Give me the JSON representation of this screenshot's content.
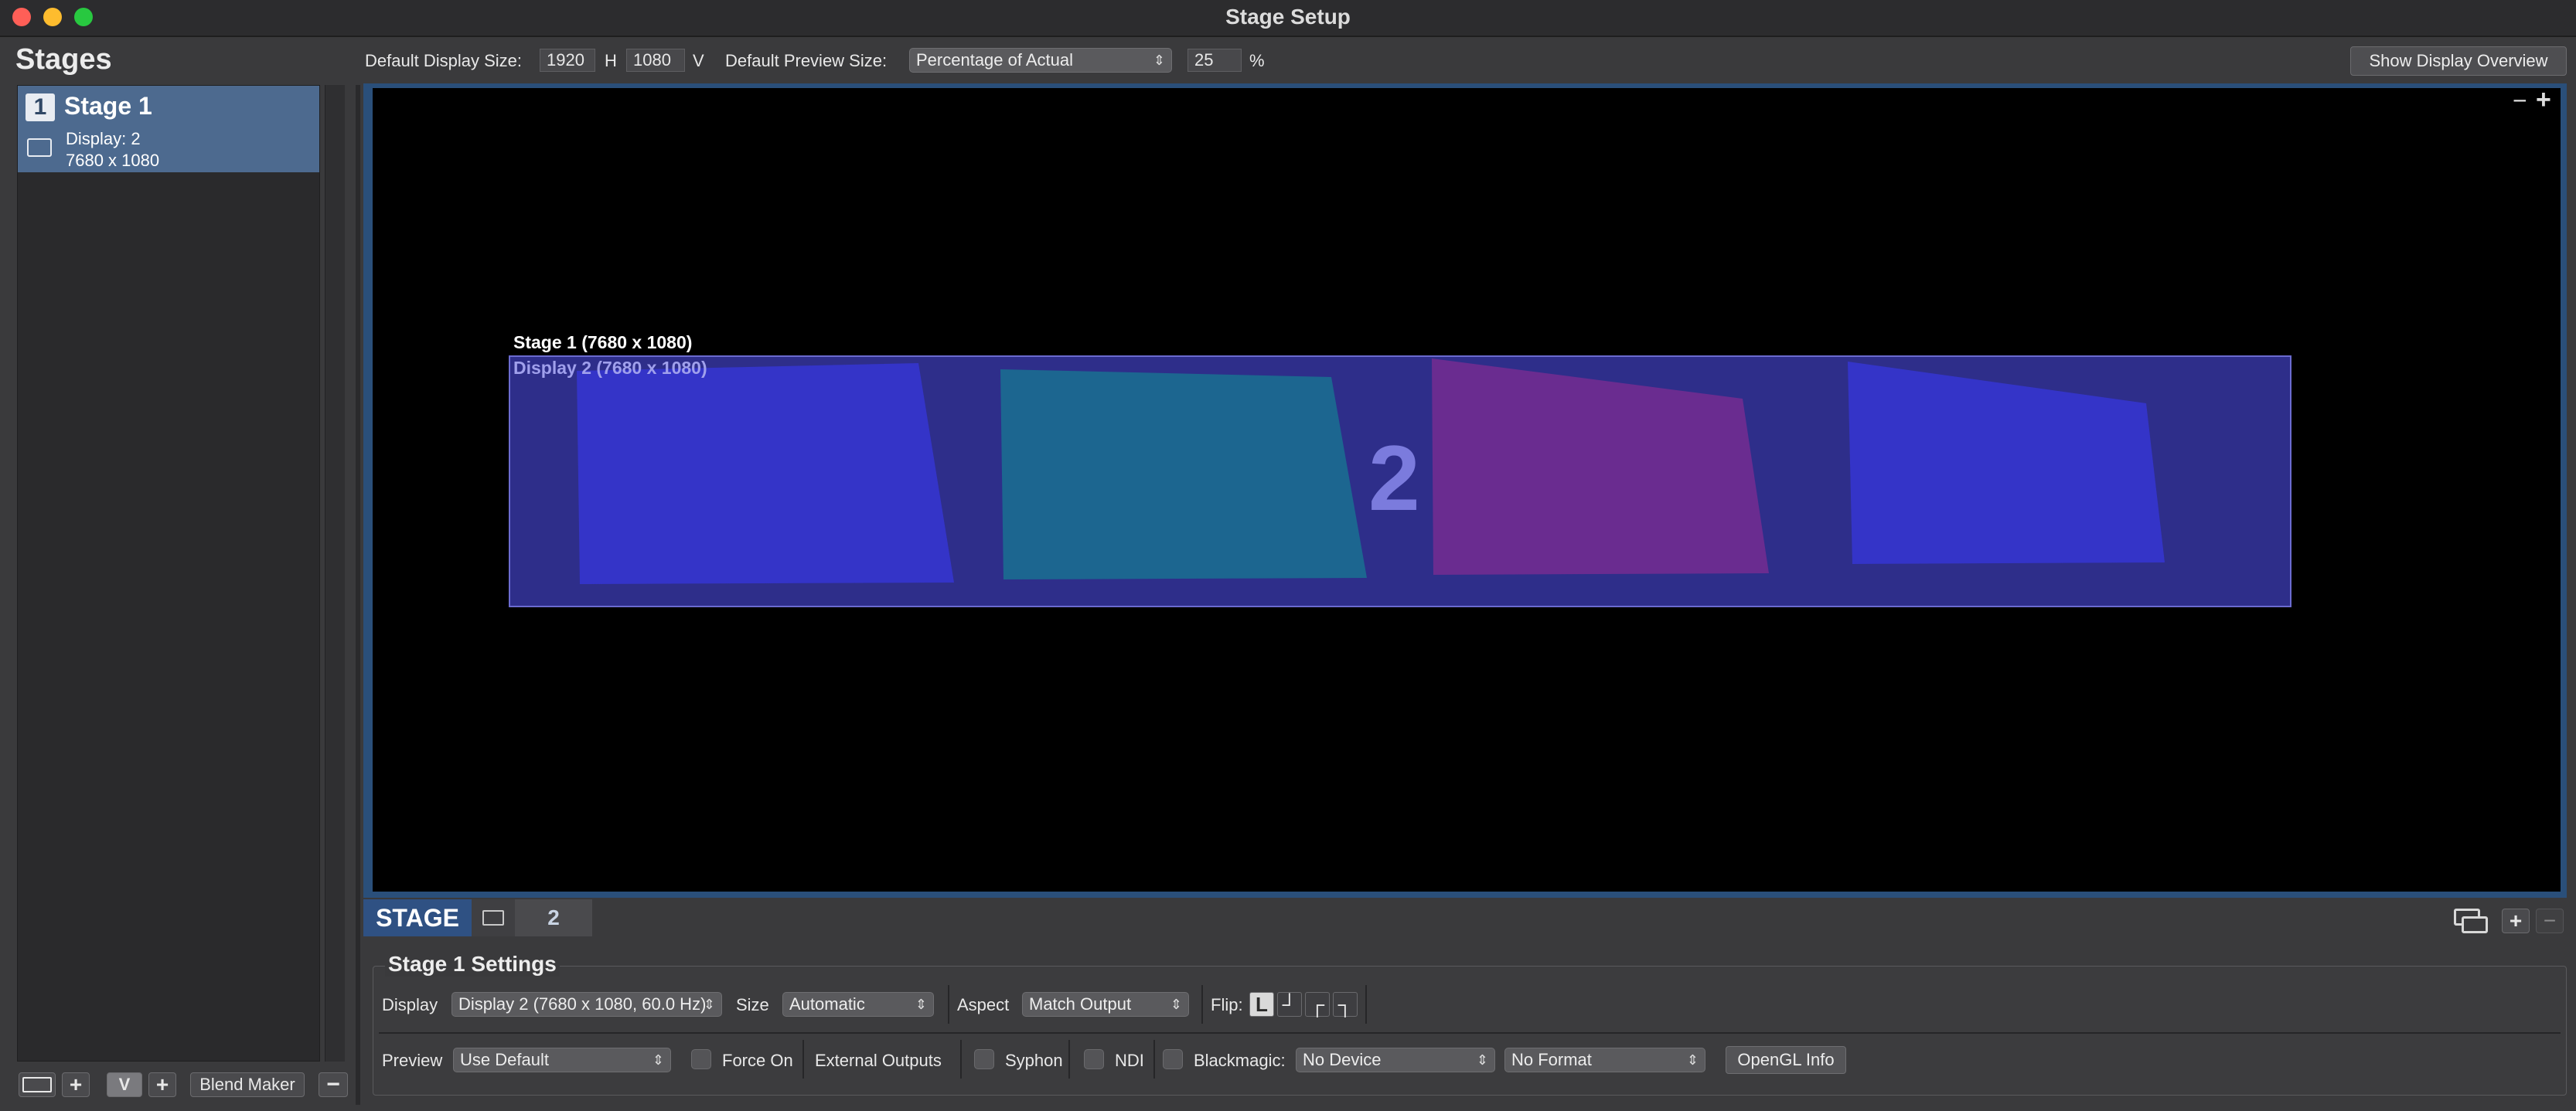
{
  "window": {
    "title": "Stage Setup"
  },
  "sidebar": {
    "header": "Stages",
    "stages": [
      {
        "number": "1",
        "name": "Stage 1",
        "display": "Display: 2",
        "resolution": "7680 x 1080"
      }
    ],
    "buttons": {
      "add": "+",
      "v": "V",
      "add_v": "+",
      "blend_maker": "Blend Maker",
      "remove": "−"
    }
  },
  "toolbar": {
    "default_display_label": "Default Display Size:",
    "width": "1920",
    "h_label": "H",
    "height": "1080",
    "v_label": "V",
    "default_preview_label": "Default Preview Size:",
    "preview_mode": "Percentage of Actual",
    "percent": "25",
    "percent_sign": "%",
    "show_overview": "Show Display Overview"
  },
  "preview": {
    "zoom_minus": "−",
    "zoom_plus": "+",
    "stage_label": "Stage 1 (7680 x 1080)",
    "display_label": "Display 2 (7680 x 1080)",
    "display_number": "2",
    "colors": {
      "display_bg": "#2e2e8a",
      "blue_quad": "#3434c8",
      "teal_quad": "#1c6690",
      "purple_quad": "#6a2c90"
    }
  },
  "tabs": {
    "stage": "STAGE",
    "display": "2"
  },
  "display_buttons": {
    "add": "+",
    "remove": "−"
  },
  "settings": {
    "title": "Stage 1 Settings",
    "display_label": "Display",
    "display_value": "Display 2 (7680 x 1080, 60.0 Hz)",
    "size_label": "Size",
    "size_value": "Automatic",
    "aspect_label": "Aspect",
    "aspect_value": "Match Output",
    "flip_label": "Flip:",
    "flip_icons": [
      "L",
      "┘",
      "┌",
      "┐"
    ],
    "preview_label": "Preview",
    "preview_value": "Use Default",
    "force_on": "Force On",
    "external_outputs": "External Outputs",
    "syphon": "Syphon",
    "ndi": "NDI",
    "blackmagic": "Blackmagic:",
    "device_value": "No Device",
    "format_value": "No Format",
    "opengl_info": "OpenGL Info"
  }
}
